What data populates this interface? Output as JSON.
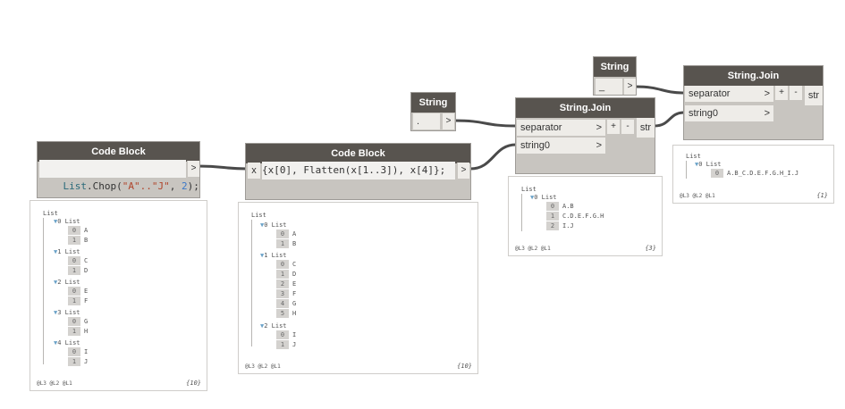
{
  "nodes": {
    "code1": {
      "title": "Code Block",
      "code_list": "List",
      "code_func": ".Chop(",
      "code_str": "\"A\"..\"J\"",
      "code_sep": ", ",
      "code_num": "2",
      "code_end": ");",
      "out": ">"
    },
    "code2": {
      "title": "Code Block",
      "in": "x",
      "code": "{x[0], Flatten(x[1..3]), x[4]};",
      "out": ">"
    },
    "str1": {
      "title": "String",
      "value": ".",
      "out": ">"
    },
    "str2": {
      "title": "String",
      "value": "_",
      "out": ">"
    },
    "join1": {
      "title": "String.Join",
      "in1": "separator",
      "in2": "string0",
      "plus": "+",
      "minus": "-",
      "out": "str",
      "arrow": ">"
    },
    "join2": {
      "title": "String.Join",
      "in1": "separator",
      "in2": "string0",
      "plus": "+",
      "minus": "-",
      "out": "str",
      "arrow": ">"
    }
  },
  "previews": {
    "p1": {
      "root": "List",
      "groups": [
        {
          "idx": "0",
          "label": "List",
          "items": [
            [
              "0",
              "A"
            ],
            [
              "1",
              "B"
            ]
          ]
        },
        {
          "idx": "1",
          "label": "List",
          "items": [
            [
              "0",
              "C"
            ],
            [
              "1",
              "D"
            ]
          ]
        },
        {
          "idx": "2",
          "label": "List",
          "items": [
            [
              "0",
              "E"
            ],
            [
              "1",
              "F"
            ]
          ]
        },
        {
          "idx": "3",
          "label": "List",
          "items": [
            [
              "0",
              "G"
            ],
            [
              "1",
              "H"
            ]
          ]
        },
        {
          "idx": "4",
          "label": "List",
          "items": [
            [
              "0",
              "I"
            ],
            [
              "1",
              "J"
            ]
          ]
        }
      ],
      "levels": "@L3 @L2 @L1",
      "count": "{10}"
    },
    "p2": {
      "root": "List",
      "groups": [
        {
          "idx": "0",
          "label": "List",
          "items": [
            [
              "0",
              "A"
            ],
            [
              "1",
              "B"
            ]
          ]
        },
        {
          "idx": "1",
          "label": "List",
          "items": [
            [
              "0",
              "C"
            ],
            [
              "1",
              "D"
            ],
            [
              "2",
              "E"
            ],
            [
              "3",
              "F"
            ],
            [
              "4",
              "G"
            ],
            [
              "5",
              "H"
            ]
          ]
        },
        {
          "idx": "2",
          "label": "List",
          "items": [
            [
              "0",
              "I"
            ],
            [
              "1",
              "J"
            ]
          ]
        }
      ],
      "levels": "@L3 @L2 @L1",
      "count": "{10}"
    },
    "p3": {
      "root": "List",
      "groups": [
        {
          "idx": "0",
          "label": "List",
          "items": [
            [
              "0",
              "A.B"
            ],
            [
              "1",
              "C.D.E.F.G.H"
            ],
            [
              "2",
              "I.J"
            ]
          ]
        }
      ],
      "levels": "@L3 @L2 @L1",
      "count": "{3}"
    },
    "p4": {
      "root": "List",
      "groups": [
        {
          "idx": "0",
          "label": "List",
          "items": [
            [
              "0",
              "A.B_C.D.E.F.G.H_I.J"
            ]
          ]
        }
      ],
      "levels": "@L3 @L2 @L1",
      "count": "{1}"
    }
  },
  "colors": {
    "header": "#58544f",
    "node_body": "#c8c5c0",
    "wire": "#4a4a4a",
    "canvas": "#ffffff"
  }
}
